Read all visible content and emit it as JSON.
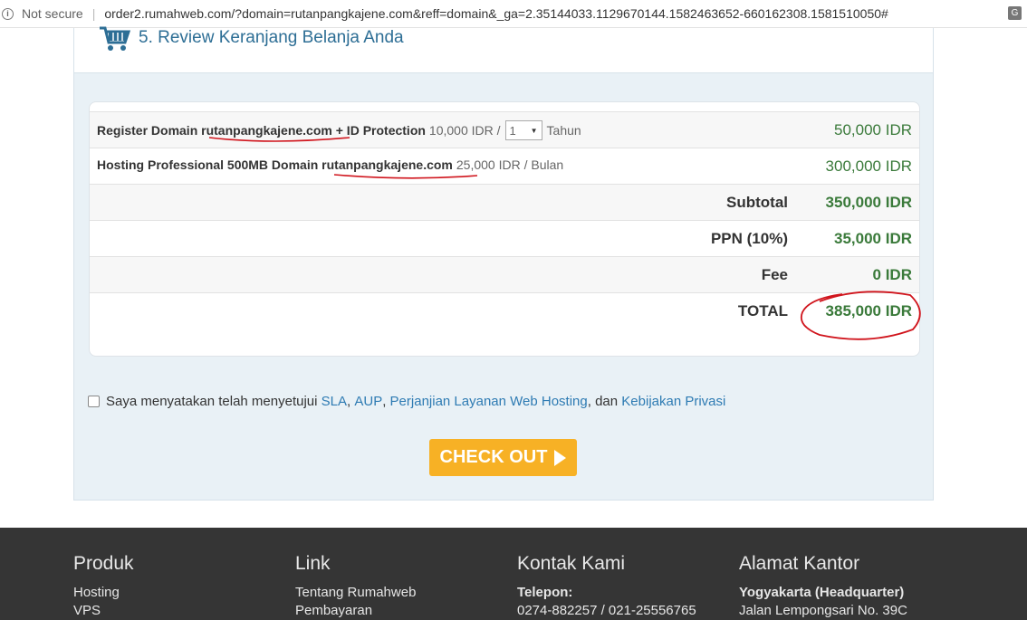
{
  "browser": {
    "security_label": "Not secure",
    "url": "order2.rumahweb.com/?domain=rutanpangkajene.com&reff=domain&_ga=2.35144033.1129670144.1582463652-660162308.1581510050#"
  },
  "review": {
    "title": "5. Review Keranjang Belanja Anda",
    "items": [
      {
        "name_prefix": "Register Domain",
        "domain": "rutanpangkajene.com",
        "name_suffix": "+ ID Protection",
        "price_text": "10,000 IDR /",
        "qty": "1",
        "unit": "Tahun",
        "amount": "50,000 IDR"
      },
      {
        "name_prefix": "Hosting Professional 500MB Domain",
        "domain": "rutanpangkajene.com",
        "price_text": "25,000 IDR / Bulan",
        "amount": "300,000 IDR"
      }
    ],
    "summary": {
      "subtotal_label": "Subtotal",
      "subtotal_value": "350,000 IDR",
      "tax_label": "PPN (10%)",
      "tax_value": "35,000 IDR",
      "fee_label": "Fee",
      "fee_value": "0 IDR",
      "total_label": "TOTAL",
      "total_value": "385,000 IDR"
    },
    "agreement": {
      "text": "Saya menyatakan telah menyetujui",
      "sep1": ",",
      "sep2": ",",
      "sep3": ", dan",
      "link_sla": "SLA",
      "link_aup": "AUP",
      "link_terms": "Perjanjian Layanan Web Hosting",
      "link_privacy": "Kebijakan Privasi"
    },
    "checkout_label": "CHECK OUT"
  },
  "footer": {
    "columns": [
      {
        "title": "Produk",
        "lines": [
          "Hosting",
          "VPS"
        ]
      },
      {
        "title": "Link",
        "lines": [
          "Tentang Rumahweb",
          "Pembayaran"
        ]
      },
      {
        "title": "Kontak Kami",
        "lines": [
          "Telepon:",
          "0274-882257 / 021-25556765"
        ]
      },
      {
        "title": "Alamat Kantor",
        "lines": [
          "Yogyakarta (Headquarter)",
          "Jalan Lempongsari No. 39C"
        ]
      }
    ]
  },
  "colors": {
    "accent_blue": "#2d6e95",
    "link_blue": "#2e7bb3",
    "price_green": "#3a7a3a",
    "checkout_orange": "#f7b125",
    "footer_bg": "#353535",
    "annotation_red": "#d0141c"
  },
  "icons": {
    "cart": "shopping-cart-icon",
    "info": "info-icon",
    "translate": "translate-icon",
    "play": "play-triangle-icon"
  }
}
